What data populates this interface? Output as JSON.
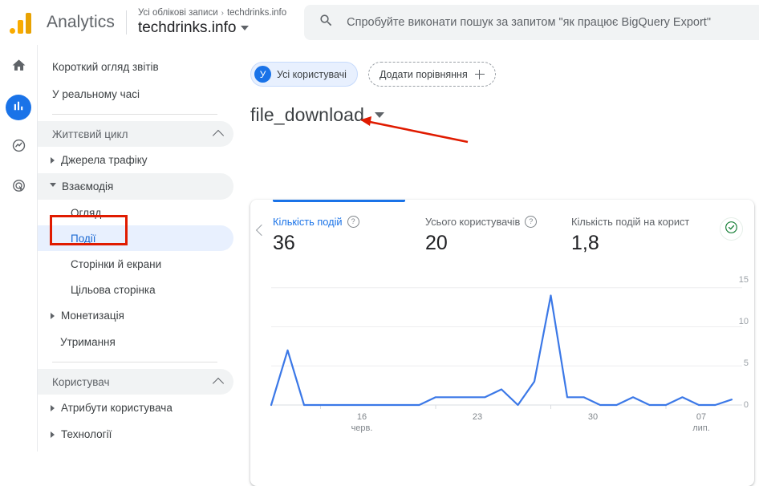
{
  "topbar": {
    "logo_icon": "analytics-logo-icon",
    "brand": "Analytics",
    "breadcrumb_root": "Усі облікові записи",
    "breadcrumb_sep": "›",
    "breadcrumb_leaf": "techdrinks.info",
    "property": "techdrinks.info",
    "search_icon": "search-icon",
    "search_placeholder": "Спробуйте виконати пошук за запитом \"як працює BigQuery Export\"",
    "search_value": ""
  },
  "rail": {
    "items": [
      {
        "icon": "home-icon",
        "name": "home",
        "active": false
      },
      {
        "icon": "bar-chart-icon",
        "name": "reports",
        "active": true
      },
      {
        "icon": "explore-icon",
        "name": "explore",
        "active": false
      },
      {
        "icon": "advertising-target-icon",
        "name": "advertising",
        "active": false
      }
    ]
  },
  "sidebar": {
    "top_items": [
      {
        "label": "Короткий огляд звітів"
      },
      {
        "label": "У реальному часі"
      }
    ],
    "groups": [
      {
        "label": "Життєвий цикл",
        "collapse_icon": "chevron-up-icon",
        "items": [
          {
            "label": "Джерела трафіку",
            "type": "parent",
            "expanded": false
          },
          {
            "label": "Взаємодія",
            "type": "parent",
            "expanded": true,
            "selected": true
          },
          {
            "label": "Огляд",
            "type": "sub",
            "active": false
          },
          {
            "label": "Події",
            "type": "sub",
            "active": true,
            "annotated": true
          },
          {
            "label": "Сторінки й екрани",
            "type": "sub",
            "active": false
          },
          {
            "label": "Цільова сторінка",
            "type": "sub",
            "active": false
          },
          {
            "label": "Монетизація",
            "type": "parent",
            "expanded": false
          },
          {
            "label": "Утримання",
            "type": "plain"
          }
        ]
      },
      {
        "label": "Користувач",
        "collapse_icon": "chevron-up-icon",
        "items": [
          {
            "label": "Атрибути користувача",
            "type": "parent",
            "expanded": false
          },
          {
            "label": "Технології",
            "type": "parent",
            "expanded": false
          }
        ]
      }
    ]
  },
  "main": {
    "chips": {
      "audience_avatar": "У",
      "audience_label": "Усі користувачі",
      "add_comparison_label": "Додати порівняння",
      "add_icon": "plus-icon"
    },
    "page_title": "file_download",
    "title_caret_icon": "chevron-down-icon",
    "card": {
      "prev_icon": "chevron-left-icon",
      "next_icon": "chevron-right-icon",
      "status_icon": "check-circle-icon",
      "metrics": [
        {
          "label": "Кількість подій",
          "value": "36",
          "help_icon": "help-icon",
          "has_help": true,
          "active": true
        },
        {
          "label": "Усього користувачів",
          "value": "20",
          "help_icon": "help-icon",
          "has_help": true,
          "active": false
        },
        {
          "label": "Кількість подій на корист",
          "value": "1,8",
          "has_help": false,
          "active": false
        }
      ]
    }
  },
  "annotations": {
    "title_arrow": {
      "icon": "red-arrow-icon",
      "color": "#e01b00"
    },
    "events_box": {
      "icon": "red-rectangle-icon",
      "color": "#e01b00"
    }
  },
  "colors": {
    "accent_blue": "#1a73e8",
    "chart_line": "#3b78e7",
    "annotation_red": "#e01b00",
    "status_green": "#188038"
  },
  "chart_data": {
    "type": "line",
    "title": "",
    "xlabel": "",
    "ylabel": "",
    "ylim": [
      0,
      16
    ],
    "yticks": [
      0,
      5,
      10,
      15
    ],
    "ytick_labels": [
      "0",
      "5",
      "10",
      "15"
    ],
    "grid": true,
    "legend": "none",
    "xtick_positions": [
      3,
      10,
      17,
      24
    ],
    "xtick_labels": [
      {
        "line1": "16",
        "line2": "черв."
      },
      {
        "line1": "23",
        "line2": ""
      },
      {
        "line1": "30",
        "line2": ""
      },
      {
        "line1": "07",
        "line2": "лип."
      }
    ],
    "series": [
      {
        "name": "Кількість подій",
        "color": "#3b78e7",
        "values": [
          0,
          7,
          0,
          0,
          0,
          0,
          0,
          0,
          0,
          0,
          1,
          1,
          1,
          1,
          2,
          0,
          3,
          14,
          1,
          1,
          0,
          0,
          1,
          0,
          0,
          1,
          0,
          0,
          0.7
        ]
      }
    ]
  }
}
